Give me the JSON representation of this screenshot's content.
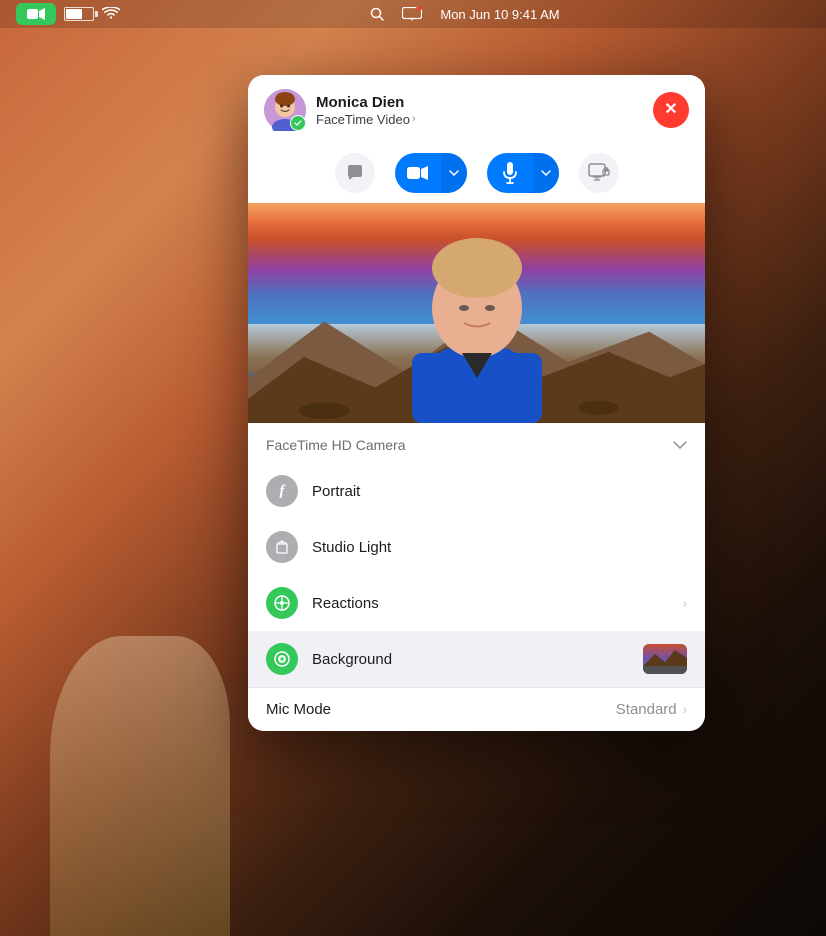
{
  "desktop": {
    "bg_colors": [
      "#c8673a",
      "#b85c32",
      "#3d2010"
    ]
  },
  "menubar": {
    "facetime_icon": "📹",
    "time": "Mon Jun 10  9:41 AM",
    "search_icon": "🔍",
    "display_icon": "⊞"
  },
  "facetime_window": {
    "contact_name": "Monica Dien",
    "call_type": "FaceTime Video",
    "call_type_chevron": "›",
    "close_label": "×",
    "controls": {
      "chat_icon": "💬",
      "video_icon": "📹",
      "mic_icon": "🎤",
      "share_icon": "⧉"
    },
    "camera_section": {
      "label": "FaceTime HD Camera",
      "chevron": "∨"
    },
    "menu_items": [
      {
        "id": "portrait",
        "label": "Portrait",
        "icon_type": "gray",
        "icon_symbol": "f",
        "has_chevron": false,
        "has_thumbnail": false
      },
      {
        "id": "studio-light",
        "label": "Studio Light",
        "icon_type": "gray",
        "icon_symbol": "◈",
        "has_chevron": false,
        "has_thumbnail": false
      },
      {
        "id": "reactions",
        "label": "Reactions",
        "icon_type": "green",
        "icon_symbol": "⊕",
        "has_chevron": true,
        "has_thumbnail": false
      },
      {
        "id": "background",
        "label": "Background",
        "icon_type": "green",
        "icon_symbol": "◉",
        "has_chevron": false,
        "has_thumbnail": true,
        "highlighted": true
      }
    ],
    "mic_mode": {
      "label": "Mic Mode",
      "value": "Standard",
      "chevron": "›"
    }
  }
}
